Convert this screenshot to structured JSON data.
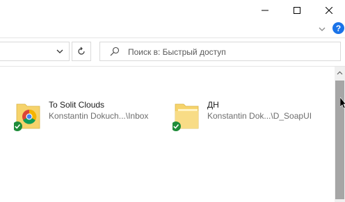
{
  "window": {
    "controls": {
      "minimize_icon": "minimize-icon",
      "maximize_icon": "maximize-icon",
      "close_icon": "close-icon"
    }
  },
  "ribbon": {
    "help_label": "?"
  },
  "search": {
    "placeholder": "Поиск в: Быстрый доступ"
  },
  "items": [
    {
      "title": "To Solit Clouds",
      "location": "Konstantin Dokuch...\\Inbox",
      "status": "synced"
    },
    {
      "title": "ДН",
      "location": "Konstantin Dok...\\D_SoapUI",
      "status": "synced"
    }
  ],
  "colors": {
    "sync_green": "#1f8c3a",
    "help_blue": "#1a73e8",
    "folder_yellow": "#f6d36b"
  }
}
